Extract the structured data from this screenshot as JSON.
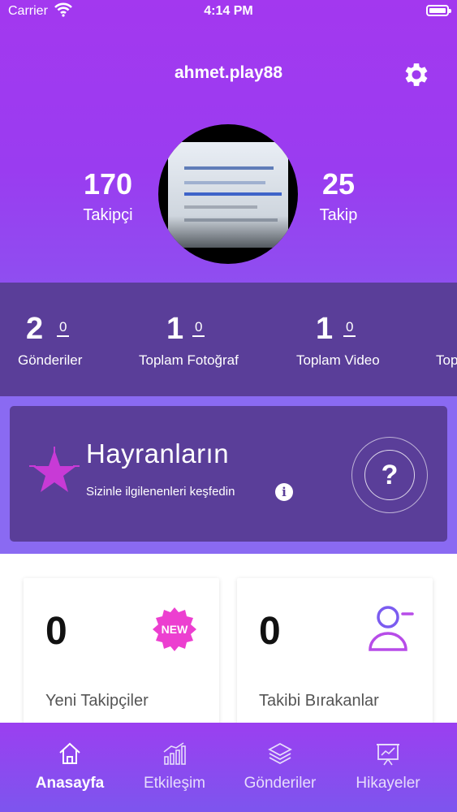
{
  "status_bar": {
    "carrier": "Carrier",
    "time": "4:14 PM"
  },
  "profile": {
    "username": "ahmet.play88",
    "followers_count": "170",
    "followers_label": "Takipçi",
    "following_count": "25",
    "following_label": "Takip"
  },
  "stats": [
    {
      "value": "2",
      "delta": "0",
      "label": "Gönderiler"
    },
    {
      "value": "1",
      "delta": "0",
      "label": "Toplam Fotoğraf"
    },
    {
      "value": "1",
      "delta": "0",
      "label": "Toplam Video"
    },
    {
      "value": "",
      "delta": "",
      "label": "Top"
    }
  ],
  "promo": {
    "title": "Hayranların",
    "subtitle": "Sizinle ilgilenenleri keşfedin",
    "info_glyph": "i",
    "question_glyph": "?"
  },
  "cards": [
    {
      "count": "0",
      "label": "Yeni Takipçiler",
      "badge": "NEW"
    },
    {
      "count": "0",
      "label": "Takibi Bırakanlar"
    }
  ],
  "tabs": [
    {
      "label": "Anasayfa",
      "icon": "home-icon",
      "active": true
    },
    {
      "label": "Etkileşim",
      "icon": "bar-chart-icon",
      "active": false
    },
    {
      "label": "Gönderiler",
      "icon": "layers-icon",
      "active": false
    },
    {
      "label": "Hikayeler",
      "icon": "presentation-icon",
      "active": false
    }
  ],
  "colors": {
    "header": "#a338ef",
    "stats_bar": "#5a3e99",
    "promo_bg": "#8a6af2",
    "new_badge": "#ec3fd0",
    "unfollow_icon": "#7b5cf0"
  }
}
